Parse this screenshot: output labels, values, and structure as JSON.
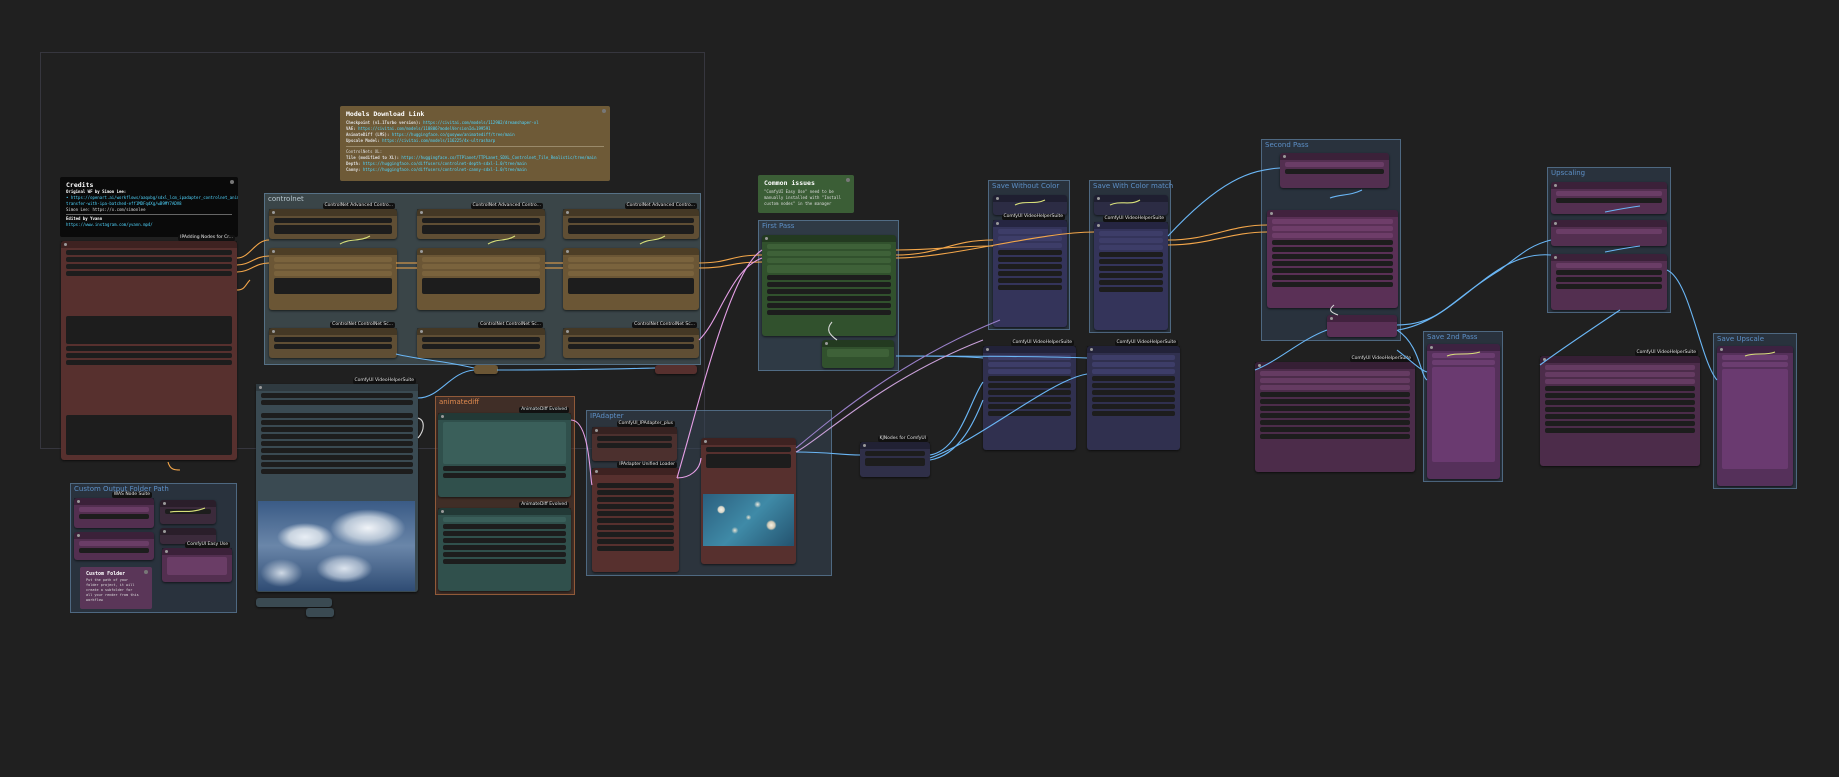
{
  "groups": {
    "controlnet": "controlnet",
    "first_pass": "First Pass",
    "save_without_color": "Save Without Color",
    "save_with_color_match": "Save With Color match",
    "second_pass": "Second Pass",
    "upscaling": "Upscaling",
    "save_2nd_pass": "Save 2nd Pass",
    "save_upscale": "Save Upscale",
    "animatediff": "animatediff",
    "ipadapter": "IPAdapter",
    "custom_output_folder_path": "Custom Output Folder Path"
  },
  "notes": {
    "models": {
      "title": "Models Download Link",
      "lines": [
        {
          "k": "Checkpoint (v1.1Turbo version):",
          "v": "https://civitai.com/models/112902/dreamshaper-xl"
        },
        {
          "k": "VAE:",
          "v": "https://civitai.com/models/118806?modelVersionId=199591"
        },
        {
          "k": "AnimateDiff (LMS):",
          "v": "https://huggingface.co/guoyww/animatediff/tree/main"
        },
        {
          "k": "Upscale Model:",
          "v": "https://civitai.com/models/116225/4x-ultrasharp"
        }
      ],
      "section": "ControlNets XL:",
      "cn_lines": [
        {
          "k": "Tile (modified to XL):",
          "v": "https://huggingface.co/TTPlanet/TTPLanet_SDXL_Controlnet_Tile_Realistic/tree/main"
        },
        {
          "k": "Depth:",
          "v": "https://huggingface.co/diffusers/controlnet-depth-sdxl-1.0/tree/main"
        },
        {
          "k": "Canny:",
          "v": "https://huggingface.co/diffusers/controlnet-canny-sdxl-1.0/tree/main"
        }
      ]
    },
    "credits": {
      "title": "Credits",
      "line1": "Original WF by Simon Lee:",
      "line2": "• https://openart.ai/workflows/aaqxbg/sdxl_lcm_ipadapter_controlnet_animatediff_vid2vid_workflow",
      "line3": "  transfer-with-ipa-batched-eff1MDFqdXg/wB9MY7ADV8",
      "line4": "Simon Lee: https://x.com/simonlee",
      "line5": "Edited by Yvann",
      "line6": "https://www.instagram.com/yvann.mp4/"
    },
    "common_issues": {
      "title": "Common issues",
      "text1": "\"ComfyUI Easy Use\" need to be",
      "text2": "manually installed with \"Install",
      "text3": "custom nodes\" in the manager"
    },
    "custom_folder": {
      "title": "Custom Folder",
      "text1": "Put the path of your",
      "text2": "folder project, it will",
      "text3": "create a subfolder for",
      "text4": "all your render from this",
      "text5": "workflow"
    }
  },
  "node_titles": {
    "ipa_unfold": "IPAdding Nodes for Cr...",
    "cn_adv_1": "ControlNet Advanced Contro...",
    "cn_adv_2": "ControlNet Advanced Contro...",
    "cn_adv_3": "ControlNet Advanced Contro...",
    "cn_load_1": "ControlNet ControlNet Sc...",
    "cn_load_2": "ControlNet ControlNet Sc...",
    "cn_load_3": "ControlNet ControlNet Sc...",
    "video_helper_load": "ComfyUI VideoHelperSuite",
    "save_vhs_1": "ComfyUI VideoHelperSuite",
    "save_vhs_2": "ComfyUI VideoHelperSuite",
    "save_vhs_3": "ComfyUI VideoHelperSuite",
    "save_vhs_4": "ComfyUI VideoHelperSuite",
    "save_vhs_5": "ComfyUI VideoHelperSuite",
    "save_vhs_6": "ComfyUI VideoHelperSuite",
    "ad_evolved_1": "AnimateDiff Evolved",
    "ad_evolved_2": "AnimateDiff Evolved",
    "ipa_plus": "ComfyUI_IPAdapter_plus",
    "ipa_unified": "IPAdapter Unified Loader",
    "kj_nodes": "KJNodes for ComfyUI",
    "was_suite": "WAS Node Suite",
    "comfy_easy_use": "ComfyUI Easy Use"
  },
  "images": {
    "clouds": "clouds image",
    "blossom": "blossom image"
  }
}
